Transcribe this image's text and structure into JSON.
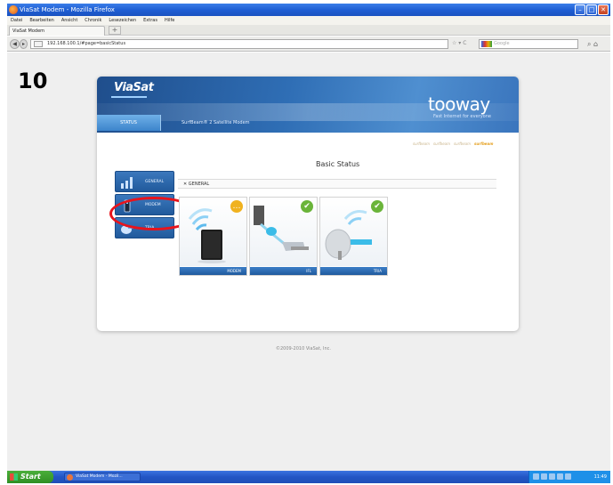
{
  "window": {
    "title": "ViaSat Modem - Mozilla Firefox"
  },
  "menu": [
    "Datei",
    "Bearbeiten",
    "Ansicht",
    "Chronik",
    "Lesezeichen",
    "Extras",
    "Hilfe"
  ],
  "tab": {
    "label": "ViaSat Modem",
    "new_tab": "+"
  },
  "navbar": {
    "url": "192.168.100.1/#page=basicStatus",
    "search_placeholder": "Google"
  },
  "step_number": "10",
  "header": {
    "brand": "ViaSat",
    "product": "tooway",
    "tagline": "Fast Internet for everyone",
    "active_tab": "STATUS",
    "subtitle": "SurfBeam® 2 Satellite Modem"
  },
  "page": {
    "title": "Basic Status",
    "section": "GENERAL",
    "ladder": [
      "surfbeam",
      "surfbeam",
      "surfbeam",
      "surfbeam"
    ]
  },
  "side_menu": [
    {
      "label": "GENERAL",
      "icon": "general-icon"
    },
    {
      "label": "MODEM",
      "icon": "modem-icon"
    },
    {
      "label": "TRIA",
      "icon": "tria-icon"
    }
  ],
  "tiles": [
    {
      "footer": "MODEM",
      "status": "warning",
      "badge": "…"
    },
    {
      "footer": "IFL",
      "status": "ok",
      "badge": "✔"
    },
    {
      "footer": "TRIA",
      "status": "ok",
      "badge": "✔"
    }
  ],
  "footer": {
    "copyright": "©2009-2010 ViaSat, Inc."
  },
  "taskbar": {
    "start": "Start",
    "task": "ViaSat Modem - Mozil...",
    "time": "11:49"
  },
  "colors": {
    "header_blue": "#2f6eb5",
    "highlight_red": "#e8141c",
    "status_ok": "#6ab43a",
    "status_warn": "#f0b21f"
  }
}
